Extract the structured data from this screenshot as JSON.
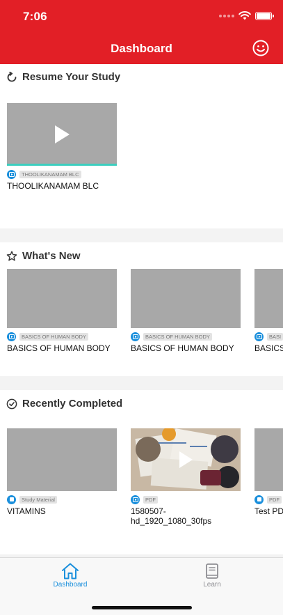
{
  "status_bar": {
    "time": "7:06"
  },
  "header": {
    "title": "Dashboard",
    "accent_color": "#e21f26",
    "profile_icon": "smiley-face-icon"
  },
  "sections": {
    "resume": {
      "title": "Resume Your Study",
      "icon": "refresh-icon",
      "items": [
        {
          "tag": "THOOLIKANAMAM BLC",
          "title": "THOOLIKANAMAM BLC",
          "type_icon": "video-icon"
        }
      ]
    },
    "whats_new": {
      "title": "What's New",
      "icon": "star-icon",
      "items": [
        {
          "tag": "BASICS OF HUMAN BODY",
          "title": "BASICS OF HUMAN BODY",
          "type_icon": "video-icon"
        },
        {
          "tag": "BASICS OF HUMAN BODY",
          "title": "BASICS OF HUMAN BODY",
          "type_icon": "video-icon"
        },
        {
          "tag": "BASI",
          "title": "BASICS",
          "type_icon": "video-icon"
        }
      ]
    },
    "recently_completed": {
      "title": "Recently Completed",
      "icon": "check-circle-icon",
      "items": [
        {
          "tag": "Study Material",
          "title": "VITAMINS",
          "type_icon": "document-icon"
        },
        {
          "tag": "PDF",
          "title_line1": "1580507-",
          "title_line2": "hd_1920_1080_30fps",
          "type_icon": "video-icon"
        },
        {
          "tag": "PDF",
          "title": "Test PD",
          "type_icon": "document-icon"
        }
      ]
    }
  },
  "tabbar": {
    "tabs": [
      {
        "label": "Dashboard",
        "icon": "home-icon",
        "active": true,
        "color": "#1a8fdc"
      },
      {
        "label": "Learn",
        "icon": "book-icon",
        "active": false,
        "color": "#8e8e93"
      }
    ]
  }
}
